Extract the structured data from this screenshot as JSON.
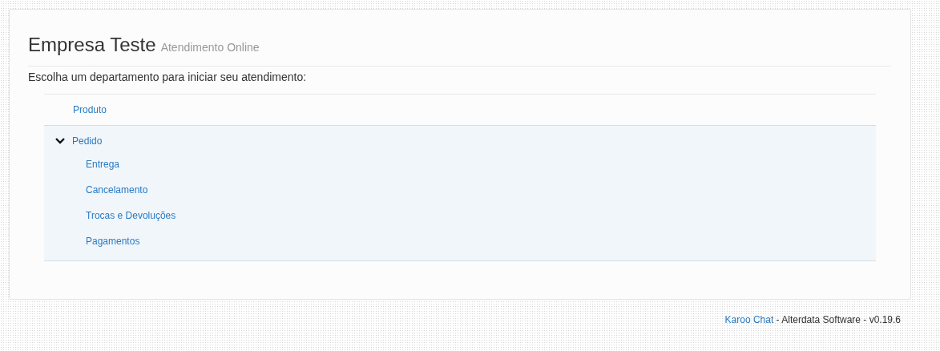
{
  "header": {
    "title": "Empresa Teste",
    "subtitle": "Atendimento Online"
  },
  "prompt": "Escolha um departamento para iniciar seu atendimento:",
  "departments": [
    {
      "label": "Produto"
    },
    {
      "label": "Pedido",
      "expanded": true,
      "children": [
        {
          "label": "Entrega"
        },
        {
          "label": "Cancelamento"
        },
        {
          "label": "Trocas e Devoluções"
        },
        {
          "label": "Pagamentos"
        }
      ]
    }
  ],
  "footer": {
    "link": "Karoo Chat",
    "text": " - Alterdata Software - v0.19.6"
  }
}
